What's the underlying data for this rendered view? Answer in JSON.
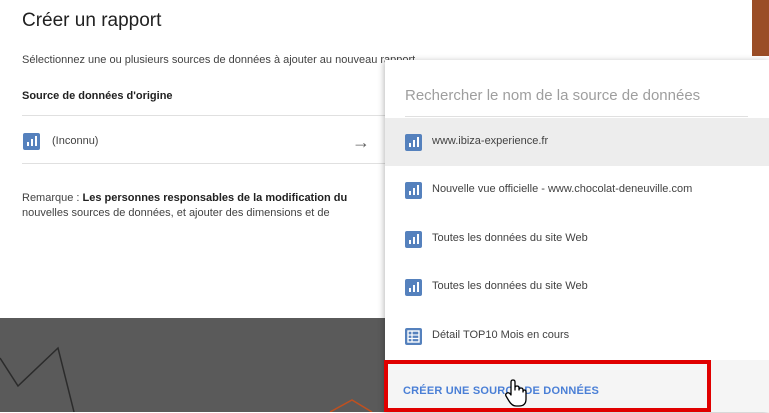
{
  "dialog": {
    "title": "Créer un rapport",
    "subtitle": "Sélectionnez une ou plusieurs sources de données à ajouter au nouveau rapport",
    "section_label": "Source de données d'origine",
    "source": {
      "name": "(Inconnu)",
      "icon": "analytics-icon"
    },
    "note": {
      "prefix": "Remarque : ",
      "bold": "Les personnes responsables de la modification du",
      "line2": "nouvelles sources de données, et ajouter des dimensions et de"
    }
  },
  "dropdown": {
    "search_placeholder": "Rechercher le nom de la source de données",
    "items": [
      {
        "label": "www.ibiza-experience.fr",
        "icon": "analytics-icon",
        "selected": true
      },
      {
        "label": "Nouvelle vue officielle - www.chocolat-deneuville.com",
        "icon": "analytics-icon"
      },
      {
        "label": "Toutes les données du site Web",
        "icon": "analytics-icon"
      },
      {
        "label": "Toutes les données du site Web",
        "icon": "analytics-icon"
      },
      {
        "label": "Détail TOP10 Mois en cours",
        "icon": "table-icon"
      }
    ],
    "create_label": "CRÉER UNE SOURCE DE DONNÉES"
  },
  "colors": {
    "accent_blue": "#4a7fd6",
    "icon_blue": "#5581bd",
    "highlight_red": "#e00000",
    "selected_bg": "#ededed"
  }
}
